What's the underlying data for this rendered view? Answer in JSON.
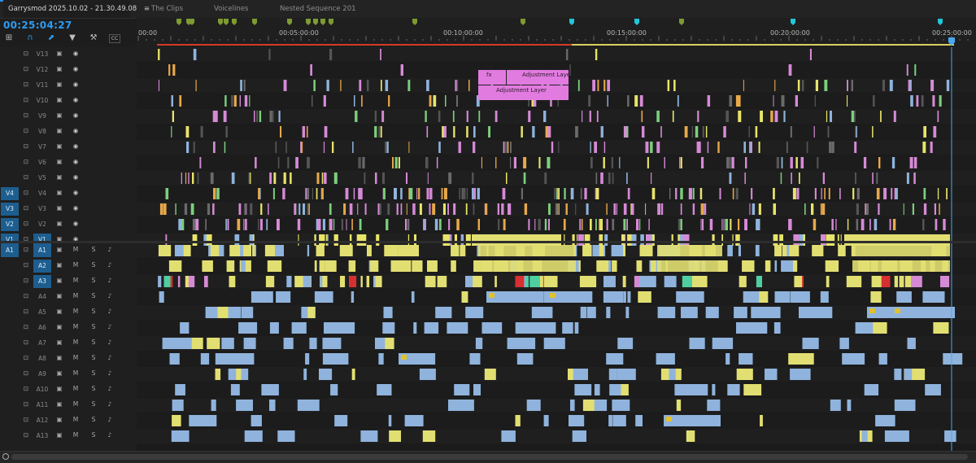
{
  "tabs": [
    {
      "label": "Garrysmod 2025.10.02 - 21.30.49.08",
      "active": true
    },
    {
      "label": "The Clips",
      "active": false
    },
    {
      "label": "Voicelines",
      "active": false
    },
    {
      "label": "Nested Sequence 201",
      "active": false
    }
  ],
  "menu_icon": "hamburger-icon",
  "playhead_timecode": "00:25:04:27",
  "tools": [
    "snap-icon",
    "linked-selection-icon",
    "add-marker-icon",
    "wrench-icon",
    "captions-icon"
  ],
  "ruler": {
    "labels": [
      "00:00",
      "00:05:00:00",
      "00:10:00:00",
      "00:15:00:00",
      "00:20:00:00",
      "00:25:00:00"
    ]
  },
  "video_tracks": [
    {
      "name": "V13",
      "target": "",
      "source": false
    },
    {
      "name": "V12",
      "target": "",
      "source": false
    },
    {
      "name": "V11",
      "target": "",
      "source": false
    },
    {
      "name": "V10",
      "target": "",
      "source": false
    },
    {
      "name": "V9",
      "target": "",
      "source": false
    },
    {
      "name": "V8",
      "target": "",
      "source": false
    },
    {
      "name": "V7",
      "target": "",
      "source": false
    },
    {
      "name": "V6",
      "target": "",
      "source": false
    },
    {
      "name": "V5",
      "target": "",
      "source": false
    },
    {
      "name": "V4",
      "target": "V4",
      "source": false
    },
    {
      "name": "V3",
      "target": "V3",
      "source": false
    },
    {
      "name": "V2",
      "target": "V2",
      "source": false
    },
    {
      "name": "V1",
      "target": "V1",
      "source": true
    }
  ],
  "audio_tracks": [
    {
      "name": "A1",
      "target": "A1",
      "source": true
    },
    {
      "name": "A2",
      "target": "",
      "source": true
    },
    {
      "name": "A3",
      "target": "",
      "source": true
    },
    {
      "name": "A4",
      "target": "",
      "source": false
    },
    {
      "name": "A5",
      "target": "",
      "source": false
    },
    {
      "name": "A6",
      "target": "",
      "source": false
    },
    {
      "name": "A7",
      "target": "",
      "source": false
    },
    {
      "name": "A8",
      "target": "",
      "source": false
    },
    {
      "name": "A9",
      "target": "",
      "source": false
    },
    {
      "name": "A10",
      "target": "",
      "source": false
    },
    {
      "name": "A11",
      "target": "",
      "source": false
    },
    {
      "name": "A12",
      "target": "",
      "source": false
    },
    {
      "name": "A13",
      "target": "",
      "source": false
    }
  ],
  "audio_buttons": {
    "mute": "M",
    "solo": "S"
  },
  "clip_labels": {
    "fx": "fx",
    "adjustment_a": "Adjustment Laye",
    "adjustment_b": "Adjustment Layer"
  },
  "colors": {
    "accent": "#2d9cf1",
    "video_clip_pink": "#d68ad6",
    "video_clip_yellow": "#e8e46a",
    "audio_clip_blue": "#8fb3dc",
    "audio_clip_yellow": "#e2df72",
    "adjustment_layer": "#e27be0",
    "marker_green": "#7e9b32",
    "marker_cyan": "#22c6d8",
    "work_area": "#e1e16a"
  }
}
